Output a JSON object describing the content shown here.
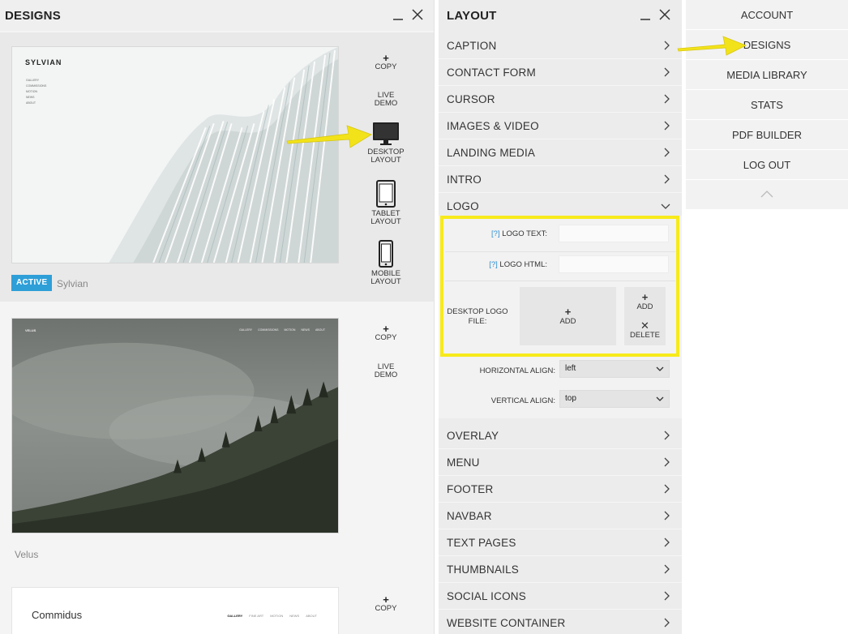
{
  "designs_panel": {
    "title": "DESIGNS",
    "cards": [
      {
        "name": "Sylvian",
        "active_label": "ACTIVE",
        "preview": {
          "logo": "SYLVIAN",
          "nav": [
            "GALLERY",
            "COMMISSIONS",
            "MOTION",
            "NEWS",
            "ABOUT"
          ]
        },
        "actions": {
          "copy": "COPY",
          "live_demo_1": "LIVE",
          "live_demo_2": "DEMO",
          "desktop_1": "DESKTOP",
          "desktop_2": "LAYOUT",
          "tablet_1": "TABLET",
          "tablet_2": "LAYOUT",
          "mobile_1": "MOBILE",
          "mobile_2": "LAYOUT"
        }
      },
      {
        "name": "Velus",
        "preview": {
          "logo": "VELUS",
          "nav": [
            "GALLERY",
            "COMMISSIONS",
            "MOTION",
            "NEWS",
            "ABOUT"
          ]
        },
        "actions": {
          "copy": "COPY",
          "live_demo_1": "LIVE",
          "live_demo_2": "DEMO"
        }
      },
      {
        "name": "Commidus",
        "preview": {
          "logo": "Commidus",
          "nav": [
            "GALLERY",
            "FINE ART",
            "MOTION",
            "NEWS",
            "ABOUT"
          ]
        },
        "actions": {
          "copy": "COPY"
        }
      }
    ]
  },
  "layout_panel": {
    "title": "LAYOUT",
    "items_top": [
      "CAPTION",
      "CONTACT FORM",
      "CURSOR",
      "IMAGES & VIDEO",
      "LANDING MEDIA",
      "INTRO",
      "LOGO"
    ],
    "logo_section": {
      "logo_text_help": "[?]",
      "logo_text_label": "LOGO TEXT:",
      "logo_text_value": "",
      "logo_html_help": "[?]",
      "logo_html_label": "LOGO HTML:",
      "logo_html_value": "",
      "desktop_logo_label_1": "DESKTOP LOGO",
      "desktop_logo_label_2": "FILE:",
      "add_label": "ADD",
      "add_small_label": "ADD",
      "delete_label": "DELETE",
      "horizontal_align_label": "HORIZONTAL ALIGN:",
      "horizontal_align_value": "left",
      "vertical_align_label": "VERTICAL ALIGN:",
      "vertical_align_value": "top"
    },
    "items_bottom": [
      "OVERLAY",
      "MENU",
      "FOOTER",
      "NAVBAR",
      "TEXT PAGES",
      "THUMBNAILS",
      "SOCIAL ICONS",
      "WEBSITE CONTAINER"
    ]
  },
  "account_menu": {
    "items": [
      "ACCOUNT",
      "DESIGNS",
      "MEDIA LIBRARY",
      "STATS",
      "PDF BUILDER",
      "LOG OUT"
    ]
  },
  "colors": {
    "active_badge": "#2f9fd8",
    "help_link": "#2f8fd0",
    "highlight": "#f7ea1b",
    "arrow": "#f2e21a"
  }
}
